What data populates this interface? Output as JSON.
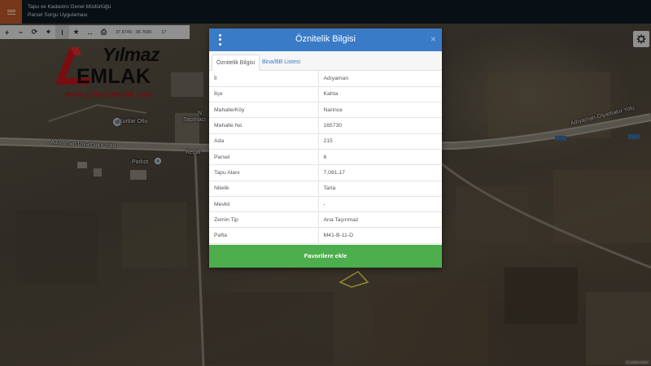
{
  "header": {
    "title_line1": "Tapu ve Kadastro Genel Müdürlüğü",
    "title_line2": "Parsel Sorgu Uygulaması",
    "menu_icon": "hamburger-icon",
    "accent": "#c0592b"
  },
  "toolbar": {
    "buttons": [
      {
        "name": "zoom-in",
        "glyph": "+"
      },
      {
        "name": "zoom-out",
        "glyph": "−"
      },
      {
        "name": "refresh",
        "glyph": "⟳"
      },
      {
        "name": "locate",
        "glyph": "⌖"
      },
      {
        "name": "info",
        "glyph": "i"
      },
      {
        "name": "favorites",
        "glyph": "★"
      },
      {
        "name": "measure",
        "glyph": "↔"
      },
      {
        "name": "print",
        "glyph": "⎙"
      }
    ],
    "coordinates": "37.8749 : 38.7680",
    "zoom": "17"
  },
  "logo": {
    "name_part1": "Yılmaz",
    "name_part2": "EMLAK",
    "url": "www.yilmazemlak.com"
  },
  "map": {
    "labels": {
      "place": "Kurtlar Otlu",
      "road_left": "Adıyaman Diyarbakır Yolu",
      "road_right": "Adıyaman-Diyarbakır Yolu",
      "road_small": "Regal",
      "park": "Parkot",
      "fragment_n": "N",
      "fragment_t": "Taşımacı"
    },
    "copyright": "© HGM Atlas"
  },
  "dialog": {
    "title": "Öznitelik Bilgisi",
    "close_label": "×",
    "tabs": [
      "Öznitelik Bilgisi",
      "Bina/BB Listesi"
    ],
    "rows": [
      {
        "key": "İl",
        "value": "Adıyaman"
      },
      {
        "key": "İlçe",
        "value": "Kahta"
      },
      {
        "key": "Mahalle/Köy",
        "value": "Narince"
      },
      {
        "key": "Mahalle No",
        "value": "165730"
      },
      {
        "key": "Ada",
        "value": "215"
      },
      {
        "key": "Parsel",
        "value": "6"
      },
      {
        "key": "Tapu Alanı",
        "value": "7,081.17"
      },
      {
        "key": "Nitelik",
        "value": "Tarla"
      },
      {
        "key": "Mevkii",
        "value": "-"
      },
      {
        "key": "Zemin Tip",
        "value": "Ana Taşınmaz"
      },
      {
        "key": "Pafta",
        "value": "M41-B-11-D"
      }
    ],
    "favorite_button": "Favorilere ekle",
    "header_color": "#3a7bc8",
    "button_color": "#4cae4c"
  }
}
